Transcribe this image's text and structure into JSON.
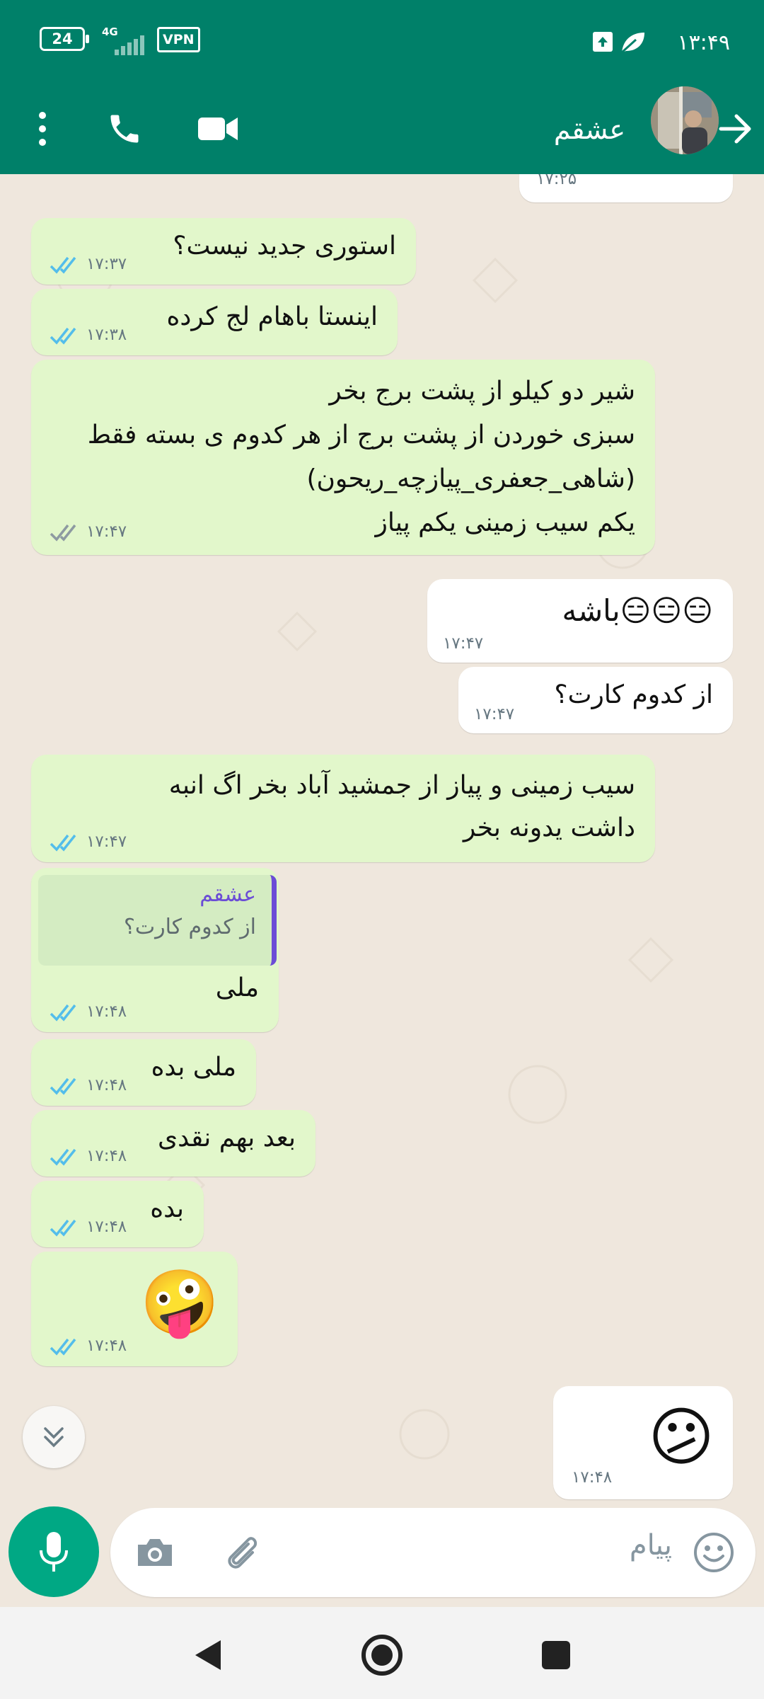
{
  "status_bar": {
    "battery": "24",
    "network": "4G",
    "vpn": "VPN",
    "time": "۱۳:۴۹"
  },
  "header": {
    "contact_name": "عشقم"
  },
  "messages": [
    {
      "dir": "in",
      "text": "استوری جدید نیست؟",
      "time": "۱۷:۳۷",
      "read": true
    },
    {
      "dir": "in",
      "text": "اینستا باهام لج کرده",
      "time": "۱۷:۳۸",
      "read": true
    },
    {
      "dir": "in",
      "text": "شیر دو کیلو از پشت برج بخر\nسبزی خوردن از پشت برج از هر کدوم ی بسته فقط\n(شاهی_جعفری_پیازچه_ریحون)\nیکم سیب زمینی یکم پیاز",
      "time": "۱۷:۴۷",
      "read": false
    },
    {
      "dir": "out",
      "text": "😑😑😑باشه",
      "time": "۱۷:۴۷"
    },
    {
      "dir": "out",
      "text": "از کدوم کارت؟",
      "time": "۱۷:۴۷"
    },
    {
      "dir": "in",
      "text": "سیب زمینی و پیاز از جمشید آباد بخر اگ انبه\nداشت یدونه بخر",
      "time": "۱۷:۴۷",
      "read": true
    },
    {
      "dir": "in",
      "quote_name": "عشقم",
      "quote_text": "از کدوم کارت؟",
      "text": "ملی",
      "time": "۱۷:۴۸",
      "read": true
    },
    {
      "dir": "in",
      "text": "ملی بده",
      "time": "۱۷:۴۸",
      "read": true
    },
    {
      "dir": "in",
      "text": "بعد بهم نقدی",
      "time": "۱۷:۴۸",
      "read": true
    },
    {
      "dir": "in",
      "text": "بده",
      "time": "۱۷:۴۸",
      "read": true
    },
    {
      "dir": "in",
      "text": "🤪",
      "time": "۱۷:۴۸",
      "read": true
    },
    {
      "dir": "out",
      "text": "😕",
      "time": "۱۷:۴۸"
    }
  ],
  "partial_top_time": "۱۷:۲۵",
  "input": {
    "placeholder": "پیام"
  },
  "colors": {
    "header": "#008069",
    "incoming_bubble": "#e2f7cb",
    "outgoing_bubble": "#ffffff",
    "read_tick": "#53bdeb",
    "accent_green": "#00a884"
  }
}
